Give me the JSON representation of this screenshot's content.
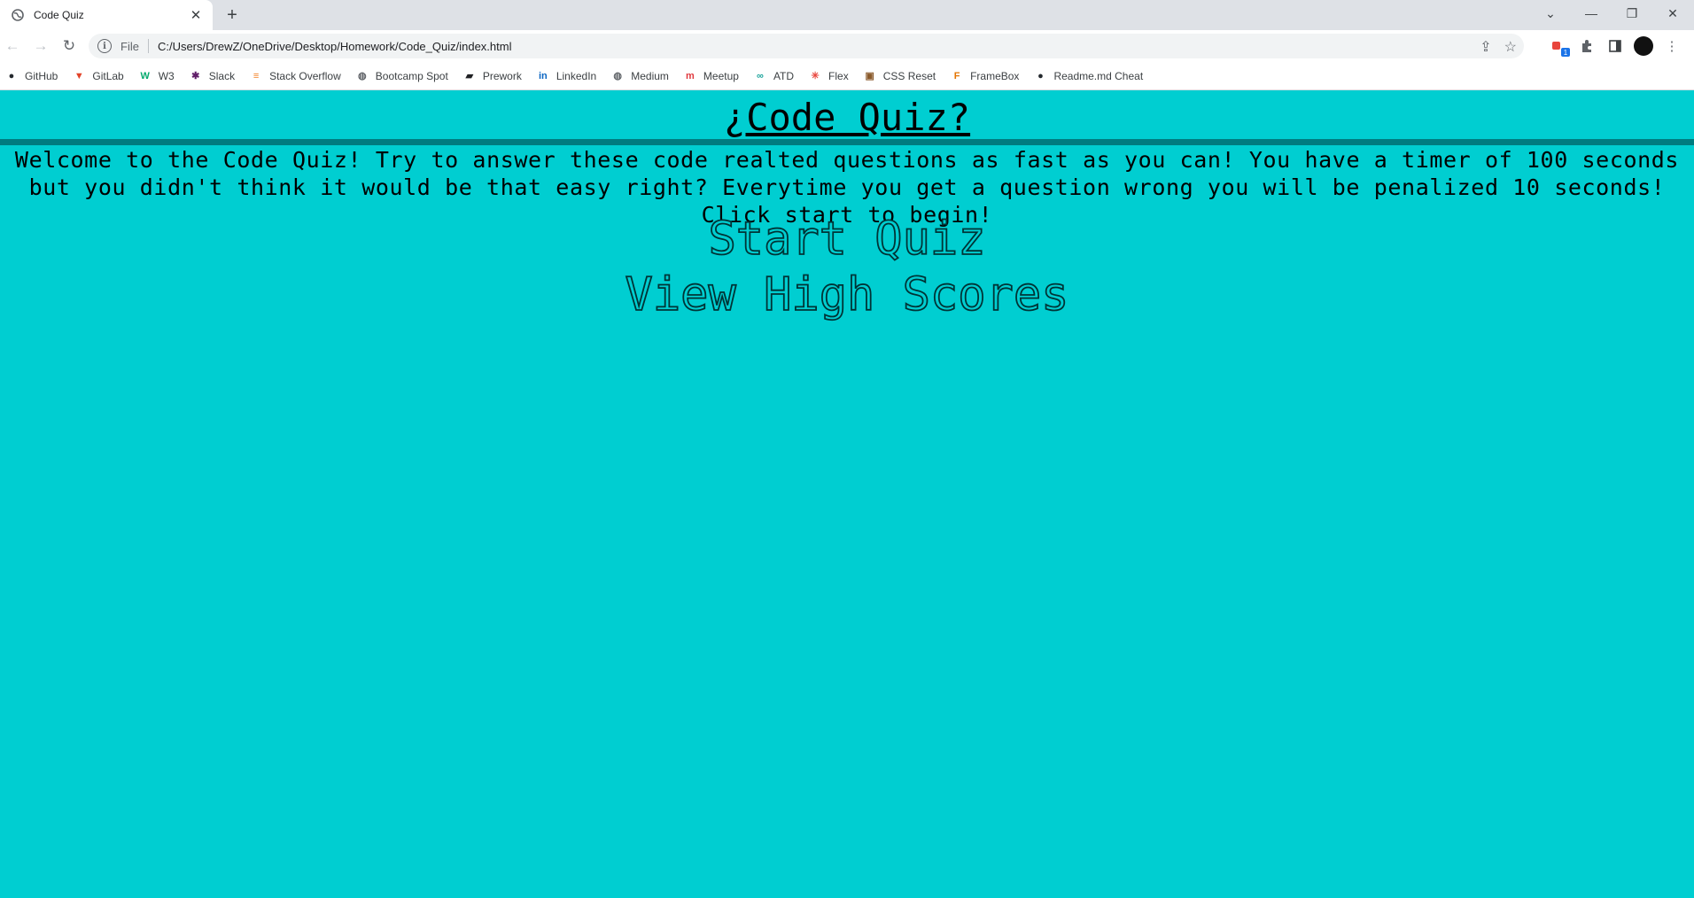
{
  "browser": {
    "tab_title": "Code Quiz",
    "url_scheme": "File",
    "url": "C:/Users/DrewZ/OneDrive/Desktop/Homework/Code_Quiz/index.html",
    "ext_badge": "1",
    "bookmarks": [
      {
        "label": "GitHub",
        "icon": "github-icon",
        "glyph": "●",
        "color": "#24292e"
      },
      {
        "label": "GitLab",
        "icon": "gitlab-icon",
        "glyph": "▼",
        "color": "#e24329"
      },
      {
        "label": "W3",
        "icon": "w3-icon",
        "glyph": "W",
        "color": "#04aa6d"
      },
      {
        "label": "Slack",
        "icon": "slack-icon",
        "glyph": "✱",
        "color": "#611f69"
      },
      {
        "label": "Stack Overflow",
        "icon": "stackoverflow-icon",
        "glyph": "≡",
        "color": "#f48024"
      },
      {
        "label": "Bootcamp Spot",
        "icon": "globe-icon",
        "glyph": "◍",
        "color": "#5f6368"
      },
      {
        "label": "Prework",
        "icon": "book-icon",
        "glyph": "▰",
        "color": "#202124"
      },
      {
        "label": "LinkedIn",
        "icon": "linkedin-icon",
        "glyph": "in",
        "color": "#0a66c2"
      },
      {
        "label": "Medium",
        "icon": "globe-icon",
        "glyph": "◍",
        "color": "#5f6368"
      },
      {
        "label": "Meetup",
        "icon": "meetup-icon",
        "glyph": "m",
        "color": "#e0393e"
      },
      {
        "label": "ATD",
        "icon": "infinity-icon",
        "glyph": "∞",
        "color": "#1aa39a"
      },
      {
        "label": "Flex",
        "icon": "asterisk-icon",
        "glyph": "✳",
        "color": "#e8453c"
      },
      {
        "label": "CSS Reset",
        "icon": "cssreset-icon",
        "glyph": "▣",
        "color": "#8a5a2b"
      },
      {
        "label": "FrameBox",
        "icon": "framebox-icon",
        "glyph": "F",
        "color": "#e37400"
      },
      {
        "label": "Readme.md Cheat",
        "icon": "github-icon",
        "glyph": "●",
        "color": "#24292e"
      }
    ]
  },
  "page": {
    "title": "¿Code Quiz?",
    "intro": "Welcome to the Code Quiz! Try to answer these code realted questions as fast as you can! You have a timer of 100 seconds but you didn't think it would be that easy right? Everytime you get a question wrong you will be penalized 10 seconds! Click start to begin!",
    "start_label": "Start Quiz",
    "scores_label": "View High Scores"
  },
  "colors": {
    "background": "#00ced1",
    "rule": "#007c80"
  }
}
